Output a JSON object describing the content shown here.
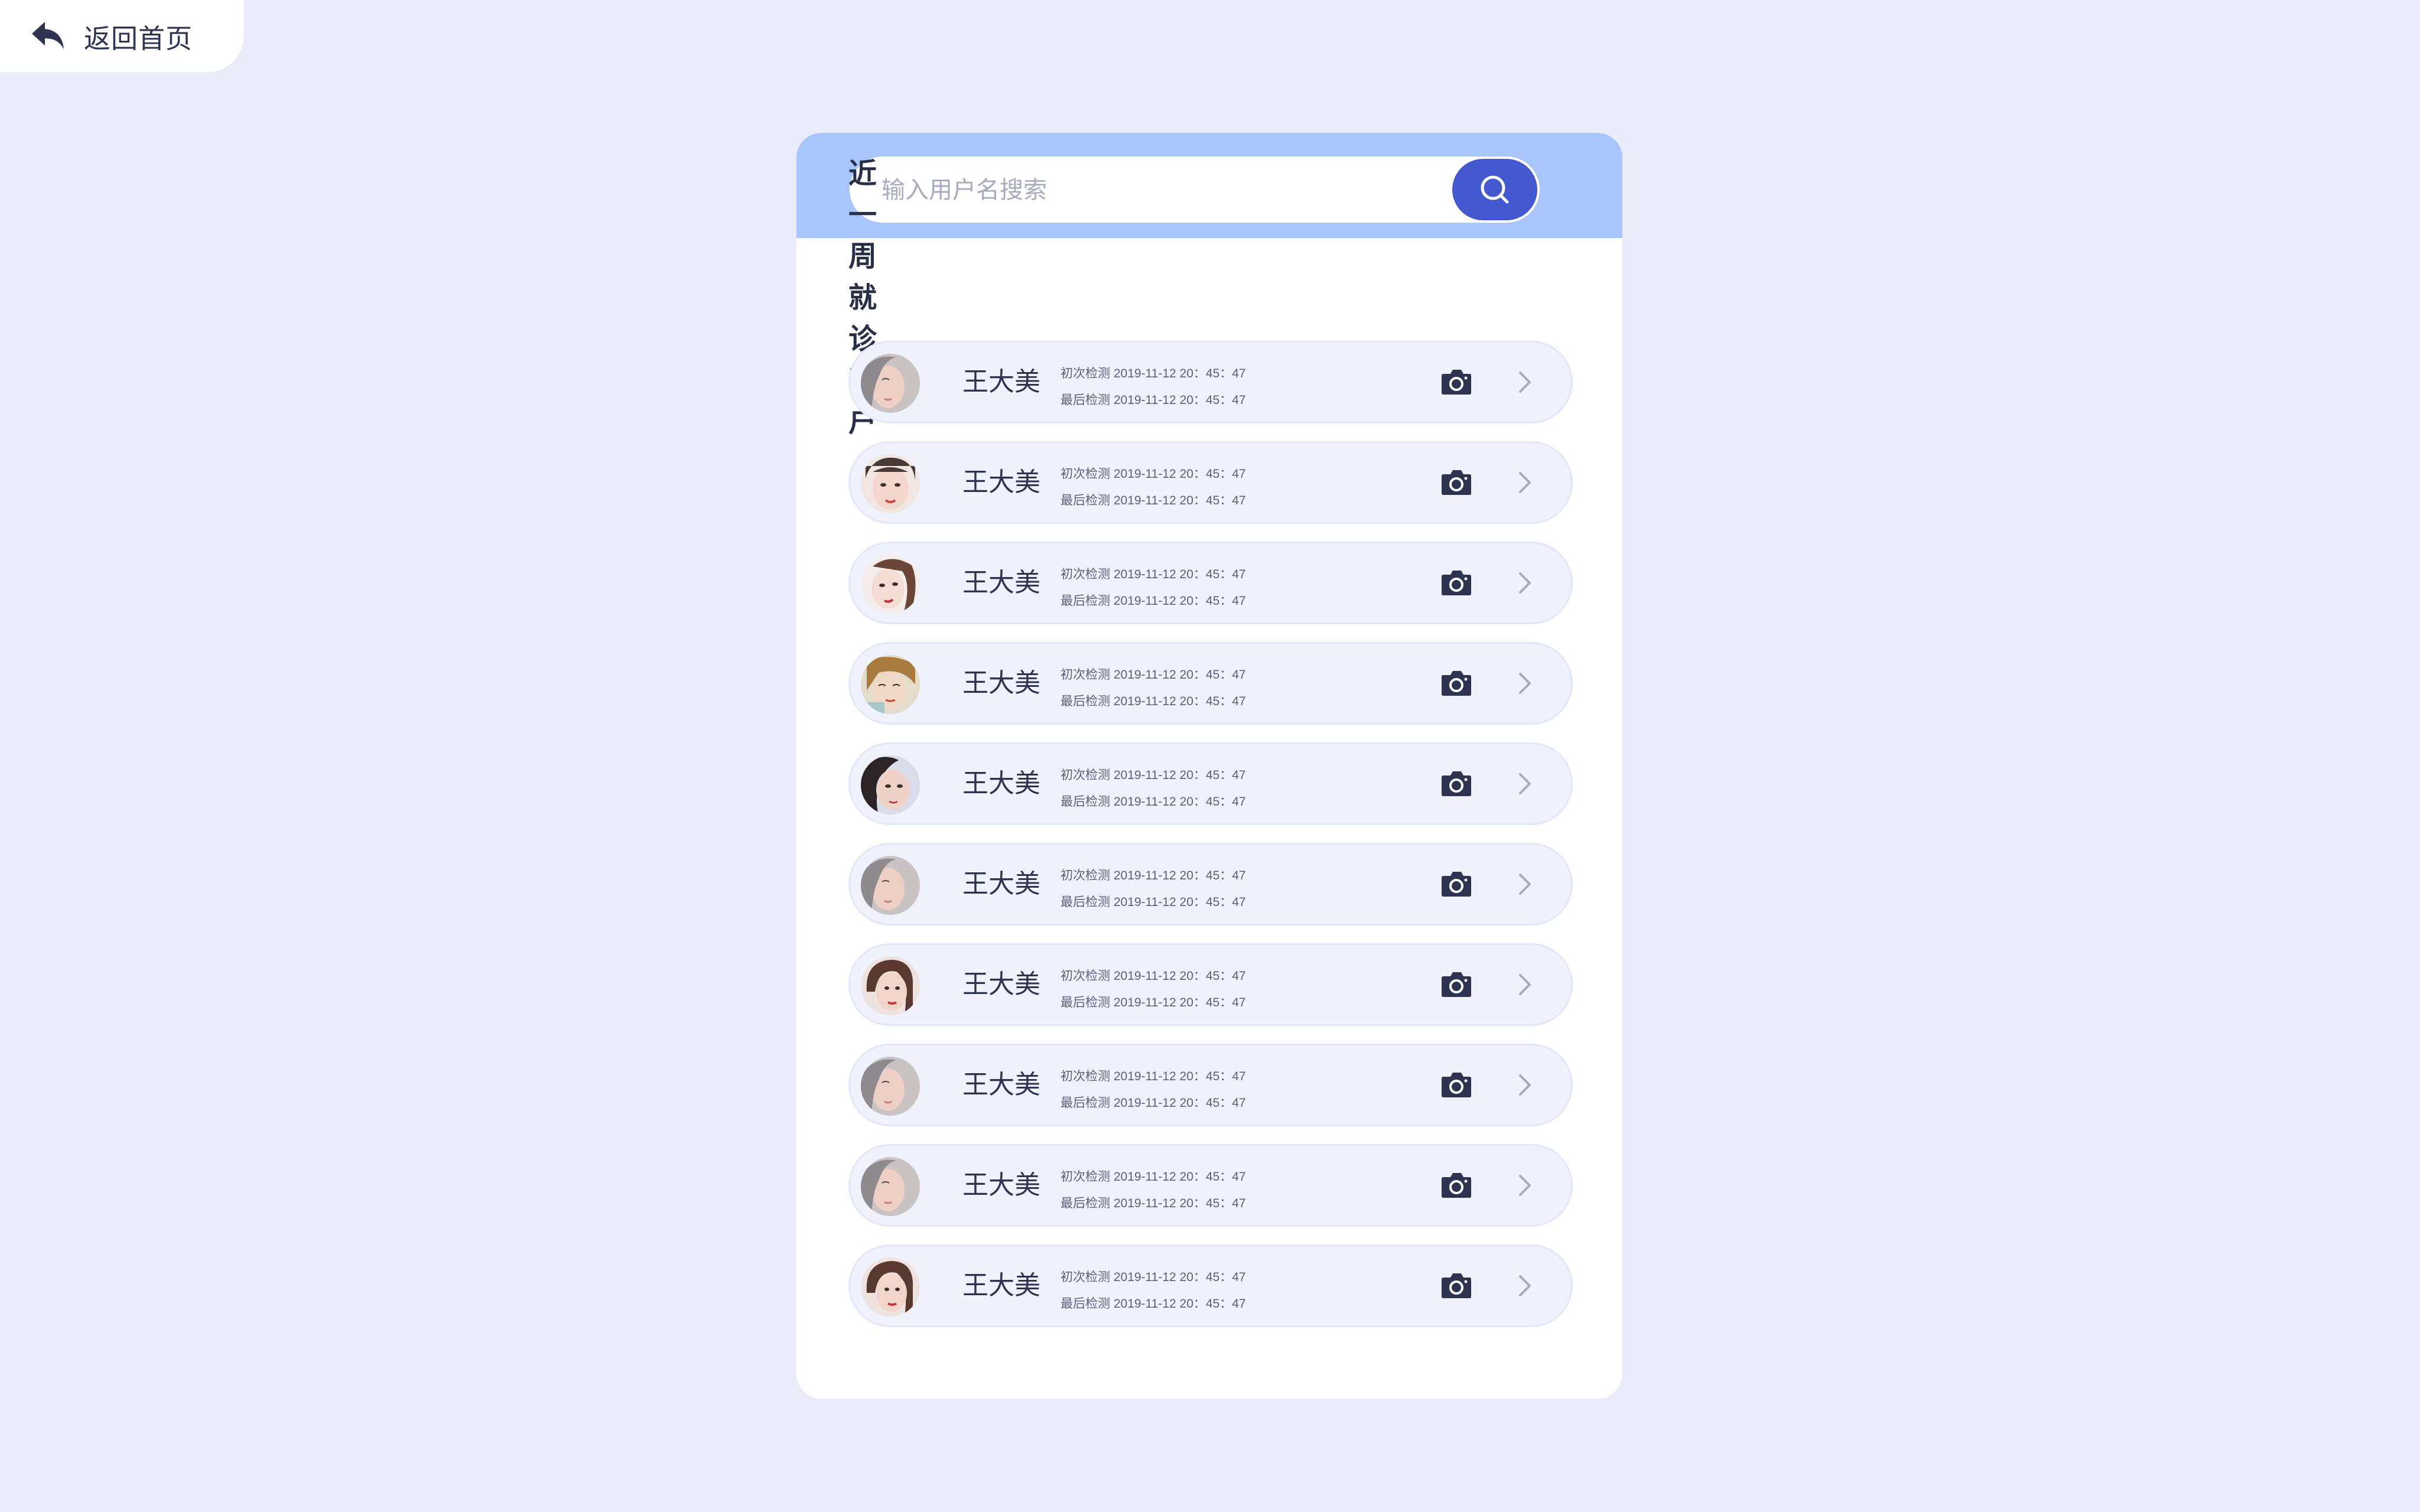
{
  "back": {
    "label": "返回首页",
    "icon": "reply-arrow-icon"
  },
  "search": {
    "placeholder": "输入用户名搜索",
    "value": "",
    "button_icon": "search-icon"
  },
  "colors": {
    "background": "#EAEDF9",
    "header": "#A9C6FC",
    "accent": "#4459CF",
    "row_bg": "#EFF1FD",
    "text_dark": "#2E3350"
  },
  "section": {
    "title": "近一周就诊客户"
  },
  "customers": [
    {
      "name": "王大美",
      "first_check": "初次检测 2019-11-12 20：45：47",
      "last_check": "最后检测 2019-11-12 20：45：47",
      "avatar": "avatar-photo-1"
    },
    {
      "name": "王大美",
      "first_check": "初次检测 2019-11-12 20：45：47",
      "last_check": "最后检测 2019-11-12 20：45：47",
      "avatar": "avatar-photo-2"
    },
    {
      "name": "王大美",
      "first_check": "初次检测 2019-11-12 20：45：47",
      "last_check": "最后检测 2019-11-12 20：45：47",
      "avatar": "avatar-photo-3"
    },
    {
      "name": "王大美",
      "first_check": "初次检测 2019-11-12 20：45：47",
      "last_check": "最后检测 2019-11-12 20：45：47",
      "avatar": "avatar-photo-4"
    },
    {
      "name": "王大美",
      "first_check": "初次检测 2019-11-12 20：45：47",
      "last_check": "最后检测 2019-11-12 20：45：47",
      "avatar": "avatar-photo-5"
    },
    {
      "name": "王大美",
      "first_check": "初次检测 2019-11-12 20：45：47",
      "last_check": "最后检测 2019-11-12 20：45：47",
      "avatar": "avatar-photo-1"
    },
    {
      "name": "王大美",
      "first_check": "初次检测 2019-11-12 20：45：47",
      "last_check": "最后检测 2019-11-12 20：45：47",
      "avatar": "avatar-photo-6"
    },
    {
      "name": "王大美",
      "first_check": "初次检测 2019-11-12 20：45：47",
      "last_check": "最后检测 2019-11-12 20：45：47",
      "avatar": "avatar-photo-1"
    },
    {
      "name": "王大美",
      "first_check": "初次检测 2019-11-12 20：45：47",
      "last_check": "最后检测 2019-11-12 20：45：47",
      "avatar": "avatar-photo-1"
    },
    {
      "name": "王大美",
      "first_check": "初次检测 2019-11-12 20：45：47",
      "last_check": "最后检测 2019-11-12 20：45：47",
      "avatar": "avatar-photo-6"
    }
  ],
  "row_icons": {
    "camera": "camera-icon",
    "chevron": "chevron-right-icon"
  }
}
